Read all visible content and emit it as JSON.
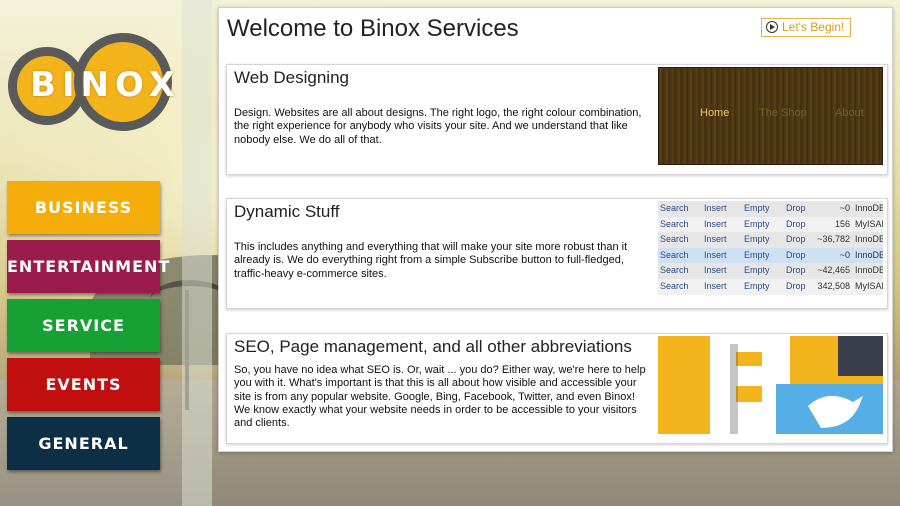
{
  "logo": {
    "text": "BINOX"
  },
  "nav": {
    "items": [
      {
        "label": "BUSINESS",
        "color": "#f5ad0c"
      },
      {
        "label": "ENTERTAINMENT",
        "color": "#9a1b4c"
      },
      {
        "label": "SERVICE",
        "color": "#17a033"
      },
      {
        "label": "EVENTS",
        "color": "#c10f10"
      },
      {
        "label": "GENERAL",
        "color": "#0d2f45"
      }
    ]
  },
  "main": {
    "title": "Welcome to Binox Services",
    "begin_label": "Let's Begin!"
  },
  "cards": [
    {
      "title": "Web Designing",
      "text": "Design. Websites are all about designs. The right logo, the right colour combination, the right experience for anybody who visits your site. And we understand that like nobody else. We do all of that.",
      "image": {
        "menu": [
          "Home",
          "The Shop",
          "About"
        ]
      }
    },
    {
      "title": "Dynamic Stuff",
      "text": "This includes anything and everything that will make your site more robust than it already is. We do everything right from a simple Subscribe button to full-fledged, traffic-heavy e-commerce sites.",
      "image": {
        "actions": [
          "Search",
          "Insert",
          "Empty",
          "Drop"
        ],
        "rows": [
          {
            "count": "~0",
            "engine": "InnoDB"
          },
          {
            "count": "156",
            "engine": "MyISAM"
          },
          {
            "count": "~36,782",
            "engine": "InnoDB"
          },
          {
            "count": "~0",
            "engine": "InnoDB"
          },
          {
            "count": "~42,465",
            "engine": "InnoDB"
          },
          {
            "count": "342,508",
            "engine": "MyISAM"
          }
        ]
      }
    },
    {
      "title": "SEO, Page management, and all other abbreviations",
      "text": "So, you have no idea what SEO is. Or, wait ... you do? Either way, we're here to help you with it. What's important is that this is all about how visible and accessible your site is from any popular website. Google, Bing, Facebook, Twitter, and even Binox! We know exactly what your website needs in order to be accessible to your visitors and clients."
    }
  ]
}
